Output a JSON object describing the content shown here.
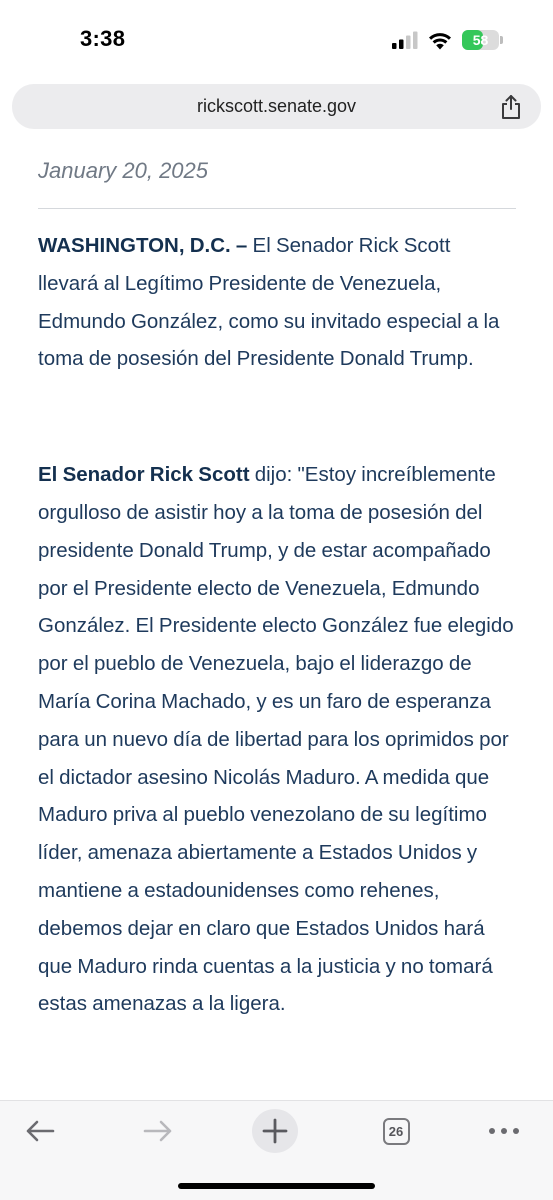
{
  "status_bar": {
    "time": "3:38",
    "battery_level": "58",
    "battery_fraction": 0.58,
    "battery_color": "#34c759"
  },
  "browser": {
    "url": "rickscott.senate.gov",
    "share_icon": "share-icon",
    "tabs_count": "26",
    "toolbar_icons": [
      "back-arrow-icon",
      "forward-arrow-icon",
      "new-tab-plus-icon",
      "tabs-icon",
      "more-icon"
    ]
  },
  "article": {
    "date": "January 20, 2025",
    "p1_lead": "WASHINGTON, D.C. –",
    "p1_body": " El Senador Rick Scott llevará al Legítimo Presidente de Venezuela, Edmundo González, como su invitado especial a la toma de posesión del Presidente Donald Trump.",
    "p2_lead": "El Senador Rick Scott",
    "p2_body": " dijo: \"Estoy increíblemente orgulloso de asistir hoy a la toma de posesión del presidente Donald Trump, y de estar acompañado por el Presidente electo de Venezuela, Edmundo González. El Presidente electo González fue elegido por el pueblo de Venezuela, bajo el liderazgo de María Corina Machado, y es un faro de esperanza para un nuevo día de libertad para los oprimidos por el dictador asesino Nicolás Maduro. A medida que Maduro priva al pueblo venezolano de su legítimo líder, amenaza abiertamente a Estados Unidos y mantiene a estadounidenses como rehenes, debemos dejar en claro que Estados Unidos hará que Maduro rinda cuentas a la justicia y no tomará estas amenazas a la ligera."
  },
  "colors": {
    "text": "#1e3a5c",
    "date": "#707985",
    "url_bar_bg": "#ececee"
  }
}
